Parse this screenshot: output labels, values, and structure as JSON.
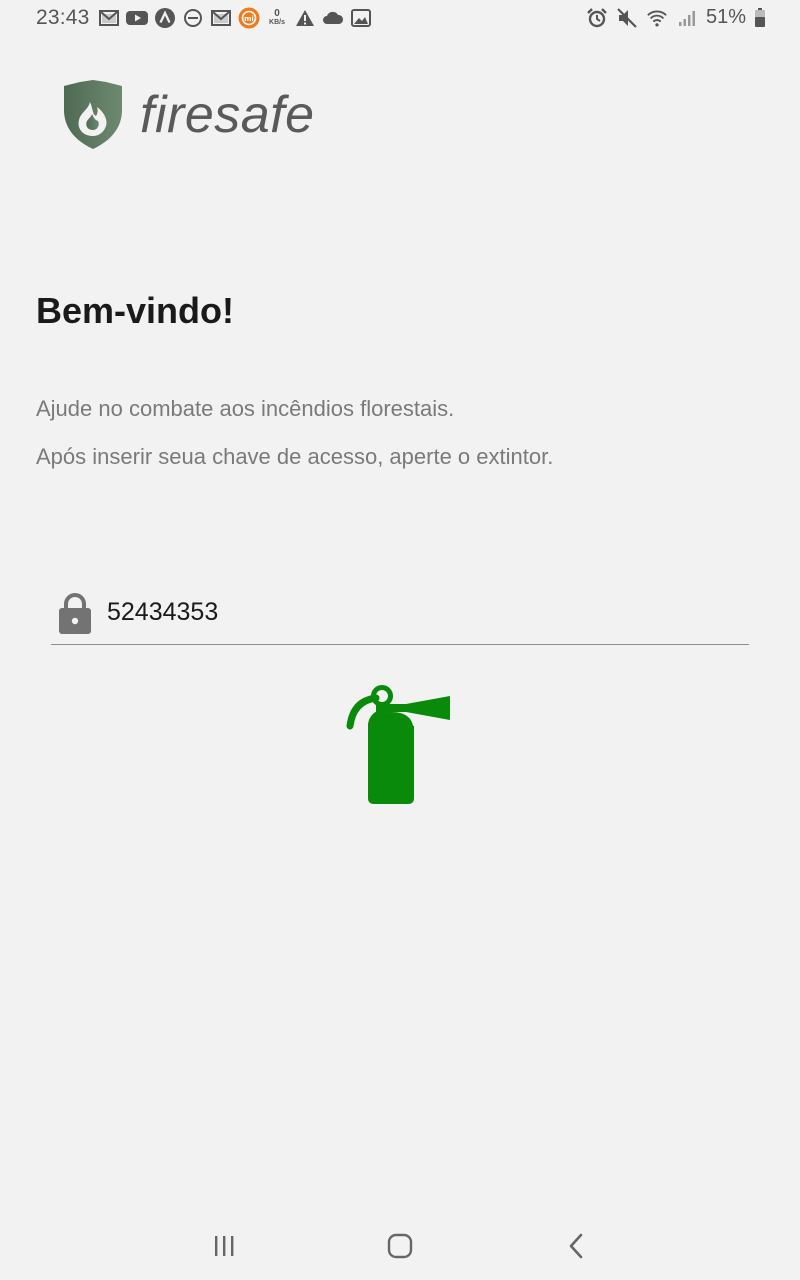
{
  "status_bar": {
    "time": "23:43",
    "net_speed_value": "0",
    "net_speed_unit": "KB/s",
    "battery_percent": "51%",
    "left_icons": [
      "gmail-icon",
      "youtube-icon",
      "app-a-icon",
      "do-not-disturb-icon",
      "gmail-icon",
      "mi-icon",
      "net-speed",
      "warning-icon",
      "cloud-icon",
      "image-icon"
    ],
    "right_icons": [
      "alarm-icon",
      "mute-icon",
      "wifi-icon",
      "signal-icon",
      "battery-icon"
    ]
  },
  "brand": {
    "name": "firesafe",
    "shield_color": "#5e7d62",
    "text_color": "#5a5a5a"
  },
  "content": {
    "title": "Bem-vindo!",
    "line1": "Ajude no combate aos incêndios florestais.",
    "line2": "Após inserir seua chave de acesso, aperte o extintor."
  },
  "access_key": {
    "value": "52434353",
    "icon": "lock-icon"
  },
  "action": {
    "icon": "fire-extinguisher-icon",
    "color": "#0a8a0a"
  },
  "nav_bar": {
    "items": [
      "recent-apps",
      "home",
      "back"
    ]
  }
}
